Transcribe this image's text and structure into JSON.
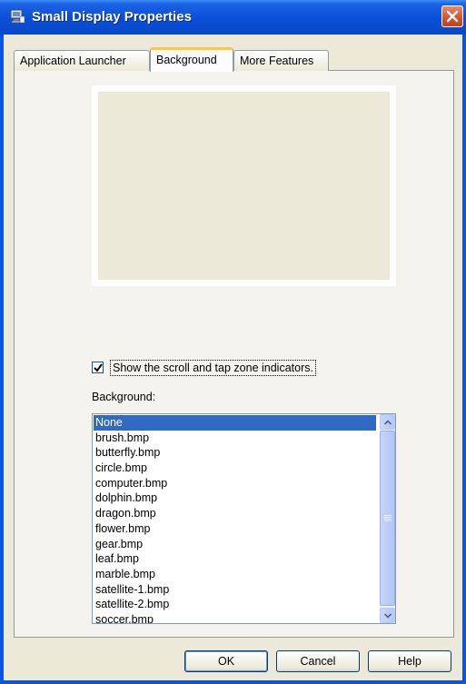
{
  "window": {
    "title": "Small Display Properties"
  },
  "tabs": [
    {
      "label": "Application Launcher"
    },
    {
      "label": "Background"
    },
    {
      "label": "More Features"
    }
  ],
  "checkbox": {
    "label": "Show the scroll and tap zone indicators.",
    "checked": true
  },
  "background_label": "Background:",
  "list": {
    "selected": "None",
    "items": [
      "None",
      "brush.bmp",
      "butterfly.bmp",
      "circle.bmp",
      "computer.bmp",
      "dolphin.bmp",
      "dragon.bmp",
      "flower.bmp",
      "gear.bmp",
      "leaf.bmp",
      "marble.bmp",
      "satellite-1.bmp",
      "satellite-2.bmp",
      "soccer.bmp"
    ]
  },
  "buttons": {
    "ok": "OK",
    "cancel": "Cancel",
    "help": "Help"
  },
  "colors": {
    "titlebar": "#0a4ed8",
    "selection": "#316ac5",
    "active_tab_accent": "#ffc83c",
    "close": "#d4502e"
  }
}
